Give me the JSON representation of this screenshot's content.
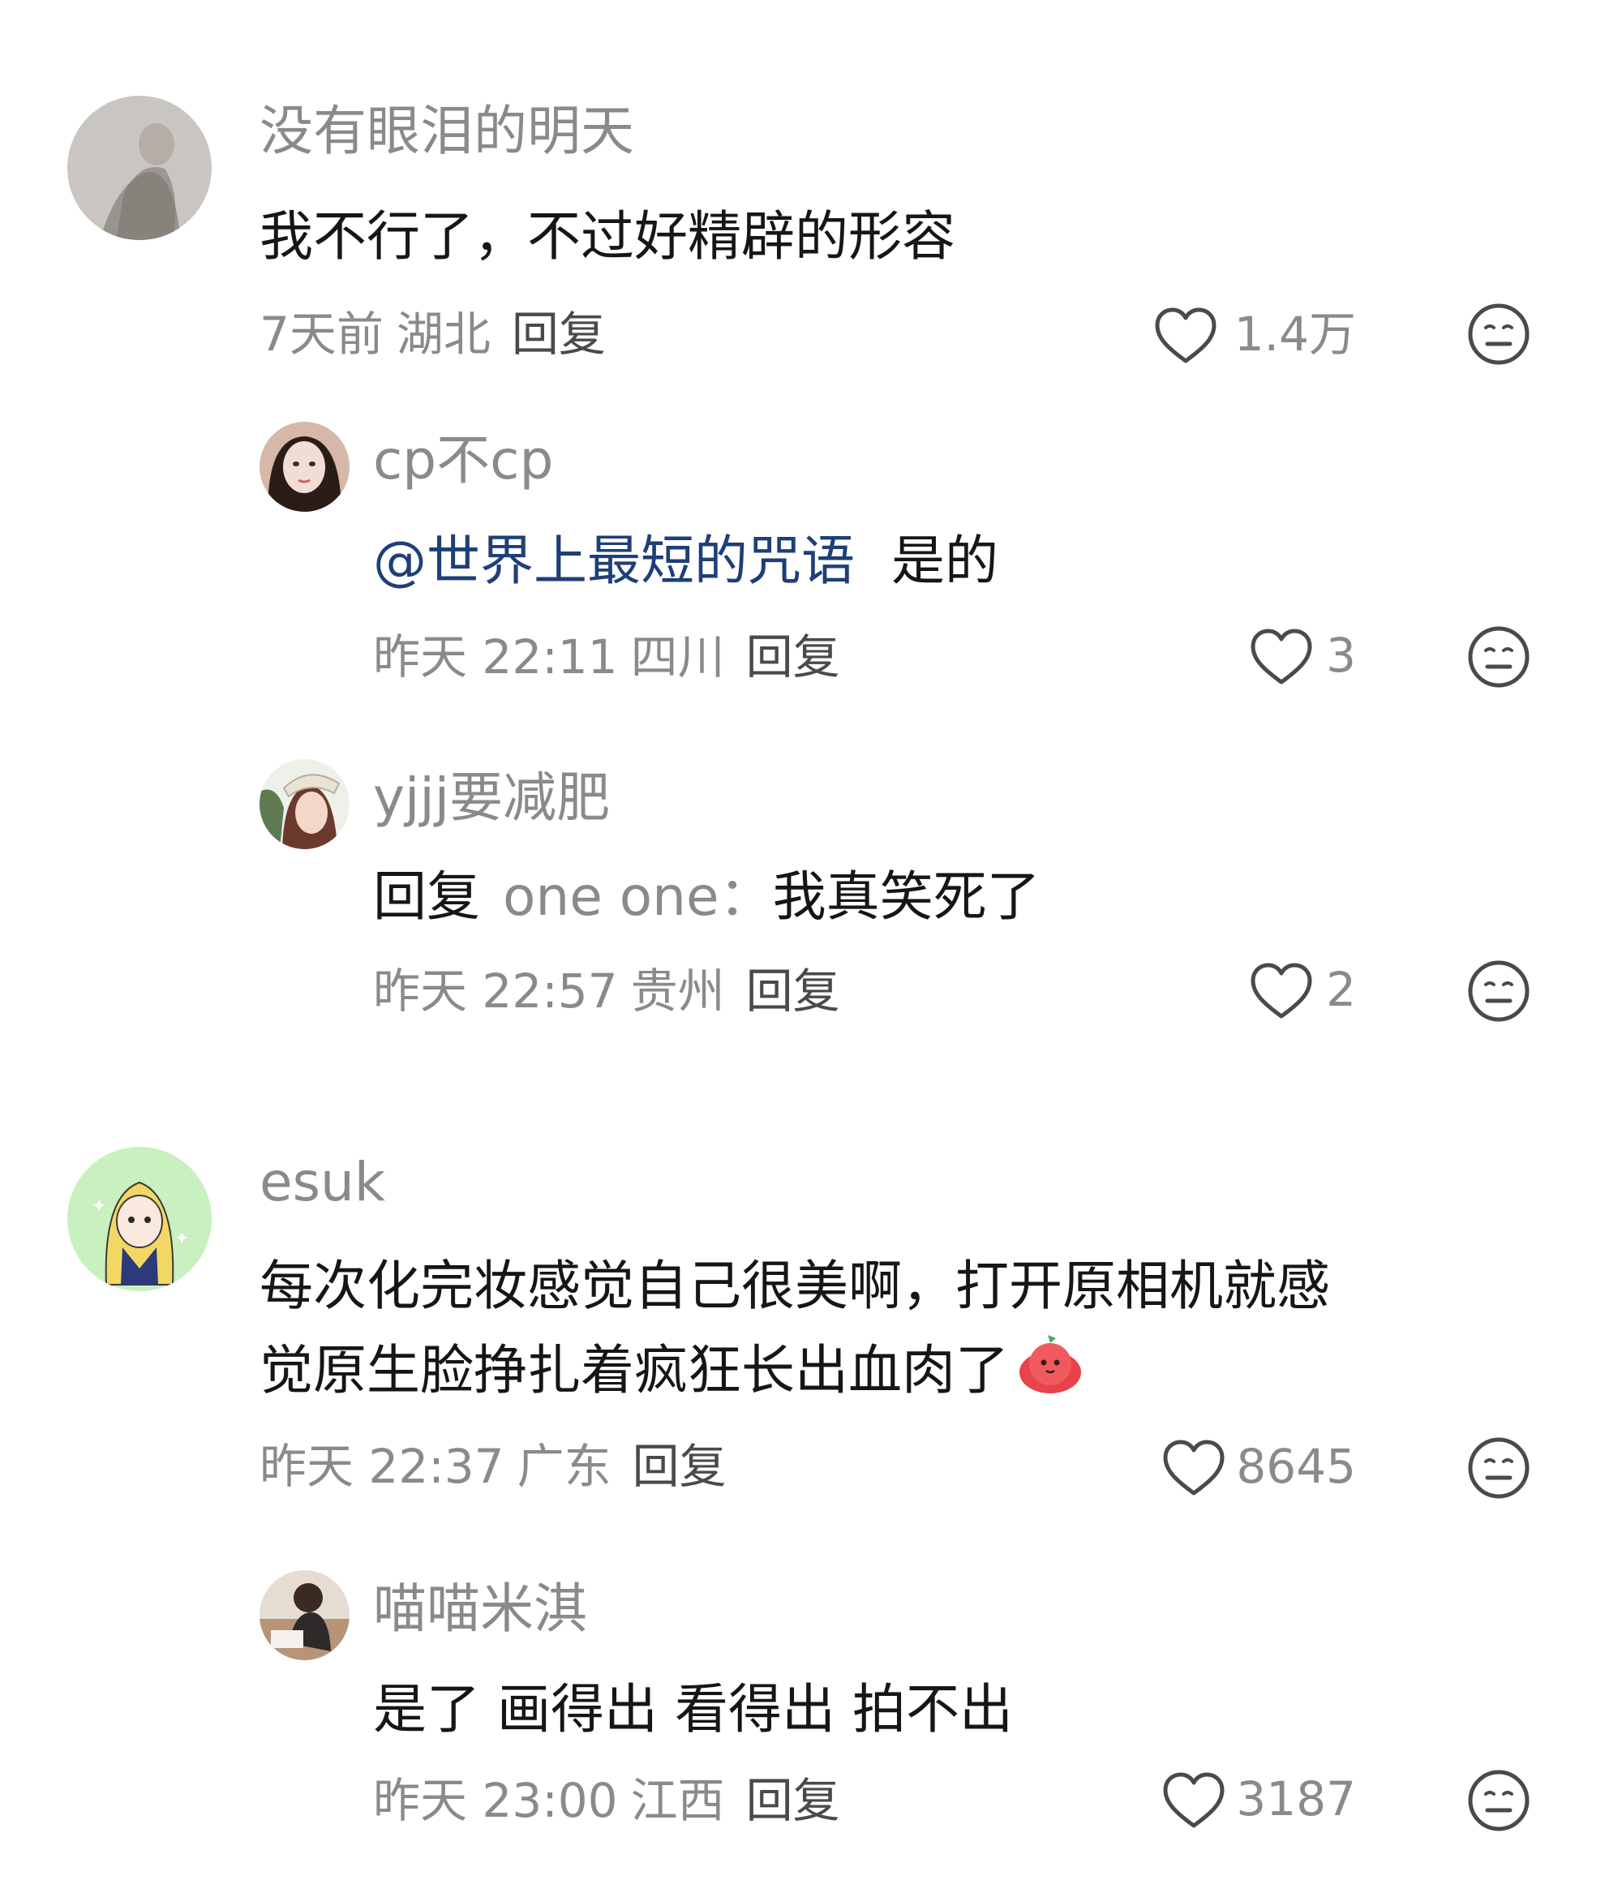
{
  "comments": [
    {
      "username": "没有眼泪的明天",
      "text": "我不行了，不过好精辟的形容",
      "time": "7天前",
      "location": "湖北",
      "reply_label": "回复",
      "likes": "1.4万",
      "replies": [
        {
          "username": "cp不cp",
          "mention": "@世界上最短的咒语",
          "text": "是的",
          "time": "昨天 22:11",
          "location": "四川",
          "reply_label": "回复",
          "likes": "3"
        },
        {
          "username": "yjjj要减肥",
          "reply_prefix": "回复",
          "reply_target": "one one：",
          "text": "我真笑死了",
          "time": "昨天 22:57",
          "location": "贵州",
          "reply_label": "回复",
          "likes": "2"
        }
      ]
    },
    {
      "username": "esuk",
      "text_line1": "每次化完妆感觉自己很美啊，打开原相机就感",
      "text_line2": "觉原生脸挣扎着疯狂长出血肉了",
      "time": "昨天 22:37",
      "location": "广东",
      "reply_label": "回复",
      "likes": "8645",
      "replies": [
        {
          "username": "喵喵米淇",
          "text": "是了 画得出 看得出 拍不出",
          "time": "昨天 23:00",
          "location": "江西",
          "reply_label": "回复",
          "likes": "3187"
        }
      ]
    }
  ],
  "icons": {
    "like": "heart-outline-icon",
    "dislike": "neutral-face-icon",
    "emoji": "red-blob-emoji"
  },
  "colors": {
    "text": "#161616",
    "secondary": "#8a8a8a",
    "mention": "#1e3f77"
  }
}
